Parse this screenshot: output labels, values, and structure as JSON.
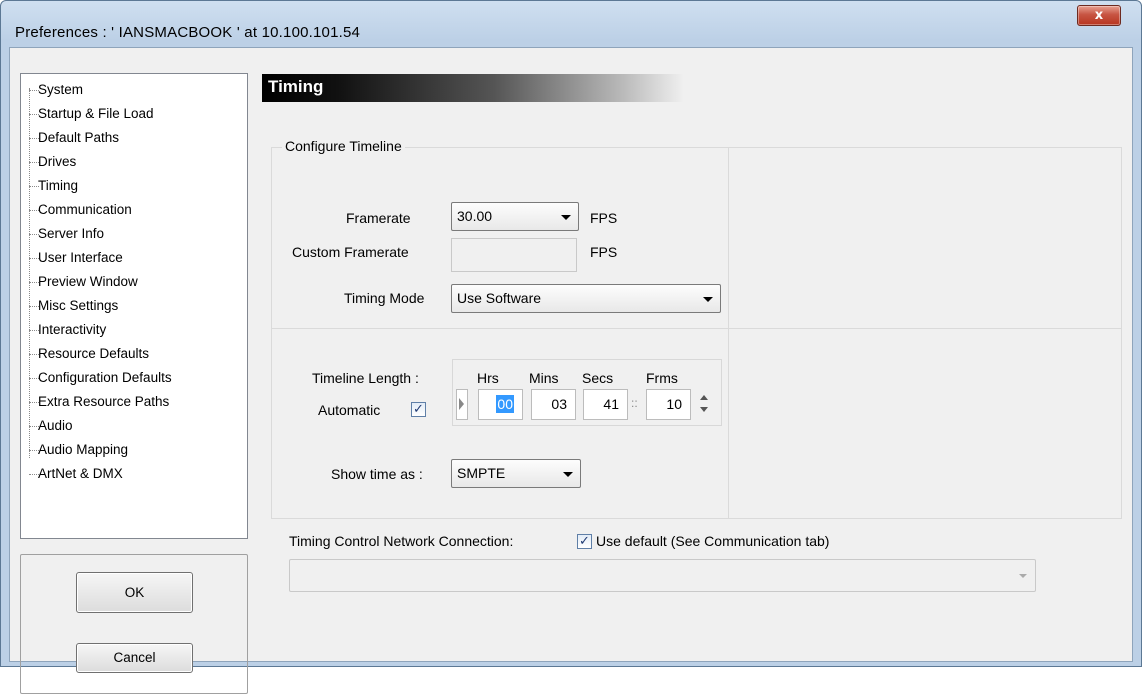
{
  "window": {
    "title": "Preferences  :  ' IANSMACBOOK '  at  10.100.101.54",
    "close_symbol": "x"
  },
  "sidebar": {
    "items": [
      {
        "label": "System"
      },
      {
        "label": "Startup & File Load"
      },
      {
        "label": "Default Paths"
      },
      {
        "label": "Drives"
      },
      {
        "label": "Timing"
      },
      {
        "label": "Communication"
      },
      {
        "label": "Server Info"
      },
      {
        "label": "User Interface"
      },
      {
        "label": "Preview Window"
      },
      {
        "label": "Misc Settings"
      },
      {
        "label": "Interactivity"
      },
      {
        "label": "Resource Defaults"
      },
      {
        "label": "Configuration Defaults"
      },
      {
        "label": "Extra Resource Paths"
      },
      {
        "label": "Audio"
      },
      {
        "label": "Audio Mapping"
      },
      {
        "label": "ArtNet & DMX"
      }
    ],
    "selected": "Timing"
  },
  "buttons": {
    "ok_label": "OK",
    "cancel_label": "Cancel"
  },
  "page": {
    "header": "Timing",
    "configure_timeline": {
      "group_label": "Configure Timeline",
      "framerate_label": "Framerate",
      "framerate_value": "30.00",
      "framerate_unit": "FPS",
      "custom_framerate_label": "Custom Framerate",
      "custom_framerate_value": "",
      "custom_framerate_unit": "FPS",
      "timing_mode_label": "Timing Mode",
      "timing_mode_value": "Use Software"
    },
    "timeline": {
      "length_label": "Timeline Length :",
      "automatic_label": "Automatic",
      "automatic_checked": true,
      "headers": {
        "hrs": "Hrs",
        "mins": "Mins",
        "secs": "Secs",
        "frms": "Frms"
      },
      "hrs": "00",
      "mins": "03",
      "secs": "41",
      "separator": "::",
      "frms": "10",
      "show_time_label": "Show time as :",
      "show_time_value": "SMPTE"
    },
    "network": {
      "label": "Timing Control Network Connection:",
      "use_default_label": "Use default (See Communication tab)",
      "use_default_checked": true,
      "connection_value": ""
    }
  },
  "icons": {
    "checkmark": "✓"
  },
  "colors": {
    "selection": "#3399ff",
    "close_button": "#c75543",
    "header_bar": "#000000"
  }
}
